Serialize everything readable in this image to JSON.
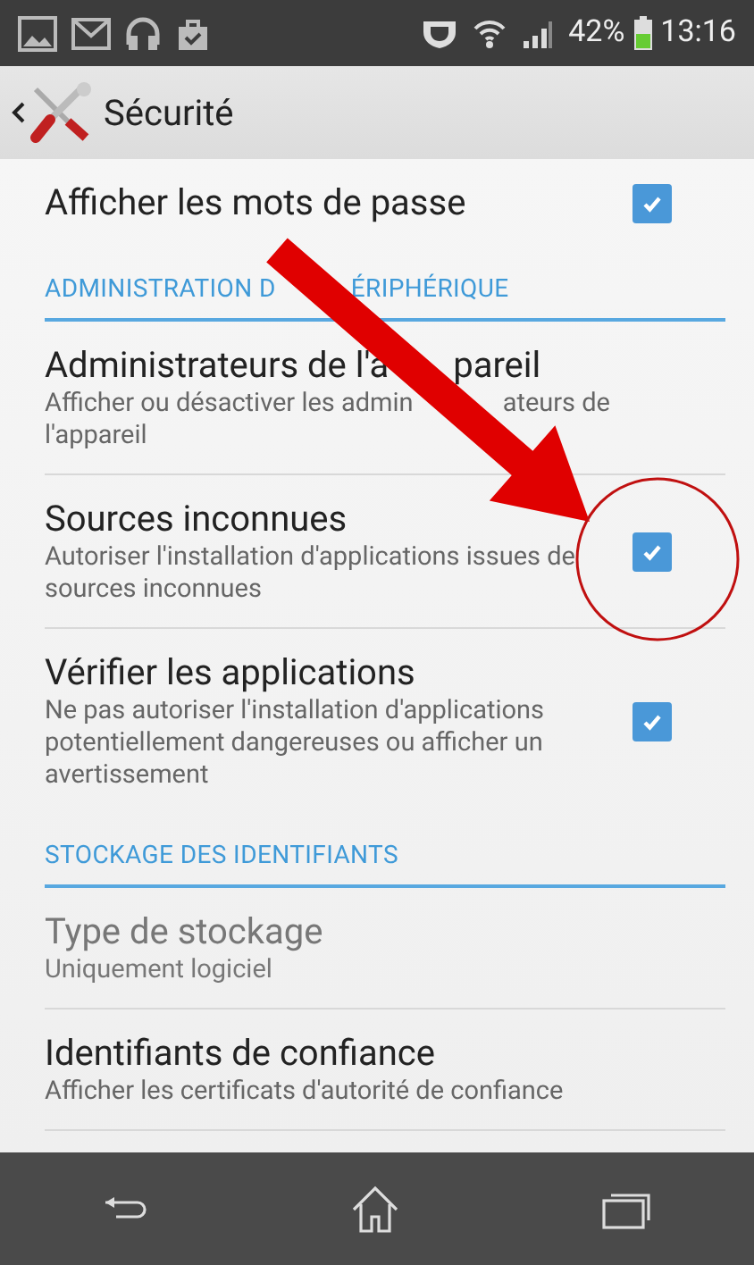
{
  "status_bar": {
    "battery": "42%",
    "time": "13:16"
  },
  "action_bar": {
    "title": "Sécurité"
  },
  "sections": [
    {
      "items": [
        {
          "title": "Afficher les mots de passe",
          "checked": true,
          "disabled": false
        }
      ]
    },
    {
      "header": [
        "ADMINISTRATION D",
        "ÉRIPHÉRIQUE"
      ],
      "items": [
        {
          "title": [
            "Administrateurs de l'a",
            "pareil"
          ],
          "summary": [
            [
              "Afficher ou désactiver les admin",
              "ateurs de"
            ],
            [
              "l'appareil"
            ]
          ],
          "disabled": false
        },
        {
          "title": "Sources inconnues",
          "summary": "Autoriser l'installation d'applications issues de sources inconnues",
          "checked": true,
          "disabled": false
        },
        {
          "title": "Vérifier les applications",
          "summary": "Ne pas autoriser l'installation d'applications potentiellement dangereuses ou afficher un avertissement",
          "checked": true,
          "disabled": false
        }
      ]
    },
    {
      "header": "STOCKAGE DES IDENTIFIANTS",
      "items": [
        {
          "title": "Type de stockage",
          "summary": "Uniquement logiciel",
          "disabled": true
        },
        {
          "title": "Identifiants de confiance",
          "summary": "Afficher les certificats d'autorité de confiance",
          "disabled": false
        }
      ]
    }
  ]
}
